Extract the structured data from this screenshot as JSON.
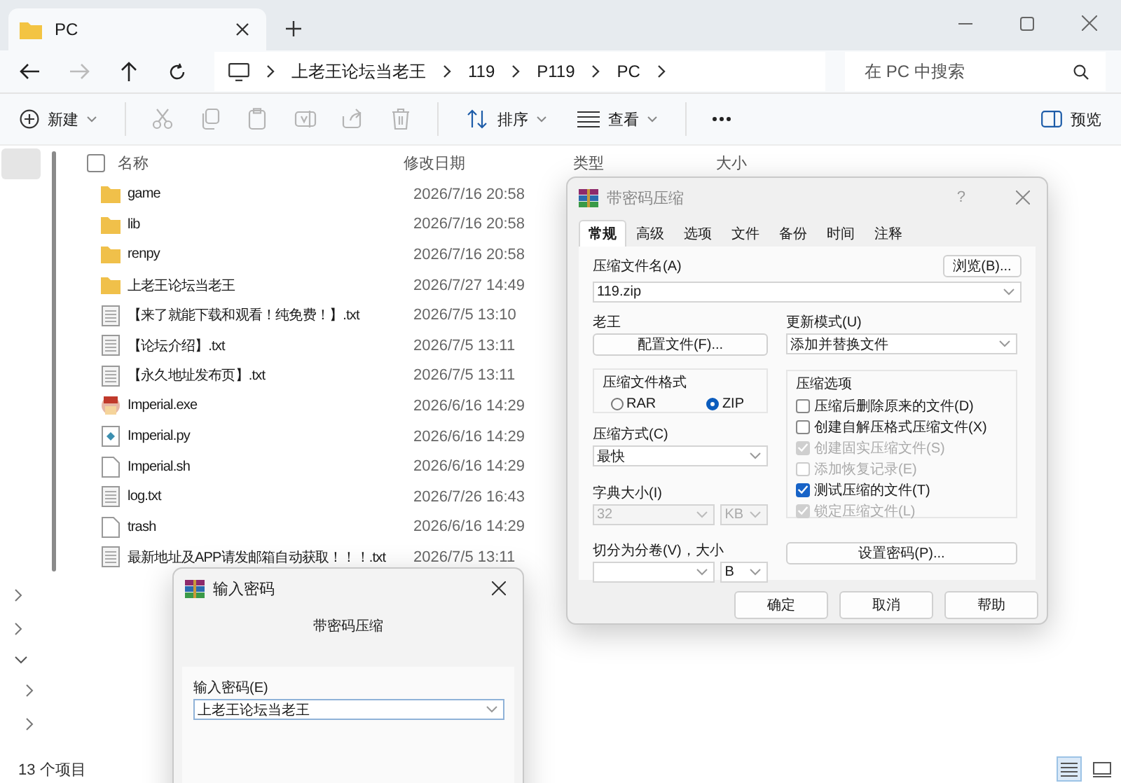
{
  "window": {
    "tab_title": "PC"
  },
  "nav": {
    "breadcrumb": [
      "上老王论坛当老王",
      "119",
      "P119",
      "PC"
    ],
    "search": {
      "placeholder": "在 PC 中搜索"
    }
  },
  "toolbar": {
    "new_label": "新建",
    "actions": [
      {
        "kind": "cut",
        "disabled": true
      },
      {
        "kind": "copy",
        "disabled": true
      },
      {
        "kind": "paste",
        "disabled": true
      },
      {
        "kind": "rename",
        "disabled": true
      },
      {
        "kind": "share",
        "disabled": true
      },
      {
        "kind": "delete",
        "disabled": true
      }
    ],
    "sort_label": "排序",
    "view_label": "查看",
    "preview_label": "预览"
  },
  "select_all": {
    "checked": false
  },
  "columns": [
    "名称",
    "修改日期",
    "类型",
    "大小"
  ],
  "files": [
    {
      "kind": "folder",
      "name": "game",
      "modified": "2026/7/16 20:58"
    },
    {
      "kind": "folder",
      "name": "lib",
      "modified": "2026/7/16 20:58"
    },
    {
      "kind": "folder",
      "name": "renpy",
      "modified": "2026/7/16 20:58"
    },
    {
      "kind": "folder",
      "name": "上老王论坛当老王",
      "modified": "2026/7/27 14:49"
    },
    {
      "kind": "text",
      "name": "【来了就能下载和观看！纯免费！】.txt",
      "modified": "2026/7/5 13:10"
    },
    {
      "kind": "text",
      "name": "【论坛介绍】.txt",
      "modified": "2026/7/5 13:11"
    },
    {
      "kind": "text",
      "name": "【永久地址发布页】.txt",
      "modified": "2026/7/5 13:11"
    },
    {
      "kind": "exe",
      "name": "Imperial.exe",
      "modified": "2026/6/16 14:29"
    },
    {
      "kind": "script",
      "name": "Imperial.py",
      "modified": "2026/6/16 14:29"
    },
    {
      "kind": "file",
      "name": "Imperial.sh",
      "modified": "2026/6/16 14:29"
    },
    {
      "kind": "text",
      "name": "log.txt",
      "modified": "2026/7/26 16:43"
    },
    {
      "kind": "file",
      "name": "trash",
      "modified": "2026/6/16 14:29"
    },
    {
      "kind": "text",
      "name": "最新地址及APP请发邮箱自动获取！！！.txt",
      "modified": "2026/7/5 13:11"
    }
  ],
  "status_bar": {
    "count": "13 个项目",
    "views": [
      {
        "kind": "details",
        "selected": true
      },
      {
        "kind": "tiles",
        "selected": false
      }
    ]
  },
  "archive_dialog": {
    "title": "带密码压缩",
    "help": "?",
    "tabs": [
      {
        "label": "常规",
        "selected": true
      },
      {
        "label": "高级",
        "selected": false
      },
      {
        "label": "选项",
        "selected": false
      },
      {
        "label": "文件",
        "selected": false
      },
      {
        "label": "备份",
        "selected": false
      },
      {
        "label": "时间",
        "selected": false
      },
      {
        "label": "注释",
        "selected": false
      }
    ],
    "name_label": "压缩文件名(A)",
    "browse_button": "浏览(B)...",
    "archive_name": "119.zip",
    "profile_label": "老王",
    "profile_button": "配置文件(F)...",
    "update_label": "更新模式(U)",
    "update_mode": "添加并替换文件",
    "format_label": "压缩文件格式",
    "formats": [
      {
        "label": "RAR",
        "selected": false
      },
      {
        "label": "ZIP",
        "selected": true
      }
    ],
    "method_label": "压缩方式(C)",
    "method": "最快",
    "dict_label": "字典大小(I)",
    "dict_size": "32",
    "dict_unit": "KB",
    "dict_disabled": true,
    "split_label": "切分为分卷(V)，大小",
    "split_unit": "B",
    "options_label": "压缩选项",
    "options": [
      {
        "label": "压缩后删除原来的文件(D)",
        "checked": false,
        "disabled": false
      },
      {
        "label": "创建自解压格式压缩文件(X)",
        "checked": false,
        "disabled": false
      },
      {
        "label": "创建固实压缩文件(S)",
        "checked": true,
        "disabled": true
      },
      {
        "label": "添加恢复记录(E)",
        "checked": false,
        "disabled": true
      },
      {
        "label": "测试压缩的文件(T)",
        "checked": true,
        "disabled": false
      },
      {
        "label": "锁定压缩文件(L)",
        "checked": true,
        "disabled": true
      }
    ],
    "password_button": "设置密码(P)...",
    "buttons": [
      "确定",
      "取消",
      "帮助"
    ]
  },
  "password_dialog": {
    "title": "输入密码",
    "subtitle": "带密码压缩",
    "label": "输入密码(E)",
    "value": "上老王论坛当老王"
  }
}
